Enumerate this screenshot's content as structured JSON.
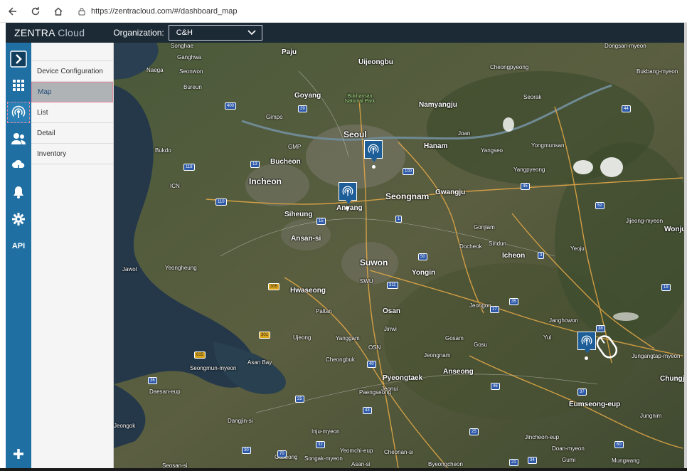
{
  "browser": {
    "url": "https://zentracloud.com/#/dashboard_map"
  },
  "header": {
    "brand_main": "ZENTRA",
    "brand_sub": "Cloud",
    "org_label": "Organization:",
    "org_value": "C&H"
  },
  "rail": {
    "api_label": "API"
  },
  "submenu": {
    "items": [
      "Device Configuration",
      "Map",
      "List",
      "Detail",
      "Inventory"
    ]
  },
  "map": {
    "places_major": [
      "Seoul",
      "Incheon",
      "Seongnam",
      "Suwon",
      "Anyang",
      "Bucheon",
      "Goyang",
      "Namyangju",
      "Ansan-si",
      "Eumseong-eup",
      "Chungju"
    ],
    "places_medium": [
      "Paju",
      "Uijeongbu",
      "Hanam",
      "Gwangju",
      "Siheung",
      "Yongin",
      "Hwaseong",
      "Osan",
      "Pyeongtaek",
      "Anseong",
      "Icheon",
      "Wonju",
      "Yeoju",
      "Gumi"
    ],
    "places_minor": [
      "Songhae",
      "Ganghwa",
      "Naega",
      "Seonwon",
      "Bureun",
      "Bukdo",
      "Jawol",
      "Yeongheung",
      "Gimpo",
      "ICN",
      "GMP",
      "SWU",
      "OSN",
      "Yanggam",
      "Cheongbuk",
      "Jinwi",
      "Gosam",
      "Paltan",
      "Ujeong",
      "Asan Bay",
      "Seongmun-myeon",
      "Daesan-eup",
      "Dangjin-si",
      "Inju-myeon",
      "Yeomchi-eup",
      "Cheonan-si",
      "Asan-si",
      "Songak-myeon",
      "Seosan-si",
      "Jeongok",
      "Cheongpyeong",
      "Joan",
      "Yangseo",
      "Seorak",
      "Yongmunsan",
      "Yangpyeong",
      "Gonjiam",
      "Docheok",
      "Sindun",
      "Janghowon",
      "Jungangtap-myeon",
      "Jincheon-eup",
      "Doan-myeon",
      "Bukbang-myeon",
      "Dongsan-myeon",
      "Jijeong-myeon",
      "Yul",
      "Gosu",
      "Jeongnam",
      "Paengseong",
      "Jeonui",
      "Byeongcheon",
      "Mungwang",
      "Goseong",
      "Jungnim",
      "Jeongon"
    ],
    "park_label": "Bukhansan National Park",
    "shields": [
      "400",
      "39",
      "100",
      "13",
      "110",
      "118",
      "15",
      "1",
      "50",
      "52",
      "3",
      "311",
      "305",
      "301",
      "615",
      "38",
      "36",
      "40",
      "43",
      "25",
      "17",
      "35",
      "45",
      "44",
      "37",
      "19",
      "46",
      "30",
      "70",
      "32",
      "21",
      "34",
      "15",
      "60",
      "25"
    ]
  },
  "markers": [
    {
      "name": "marker-seoul"
    },
    {
      "name": "marker-anyang"
    },
    {
      "name": "marker-eumseong"
    }
  ],
  "colors": {
    "header_bg": "#1c2a36",
    "rail_bg": "#1f6fa3",
    "marker_bg": "#1d5e99",
    "selected_bg": "#b0b3b5",
    "selected_border": "#e98aa0"
  },
  "icons": {
    "rail": [
      "collapse-arrow-icon",
      "grid-icon",
      "antenna-icon",
      "users-icon",
      "cloud-download-icon",
      "bell-icon",
      "gear-icon",
      "plus-icon"
    ]
  }
}
